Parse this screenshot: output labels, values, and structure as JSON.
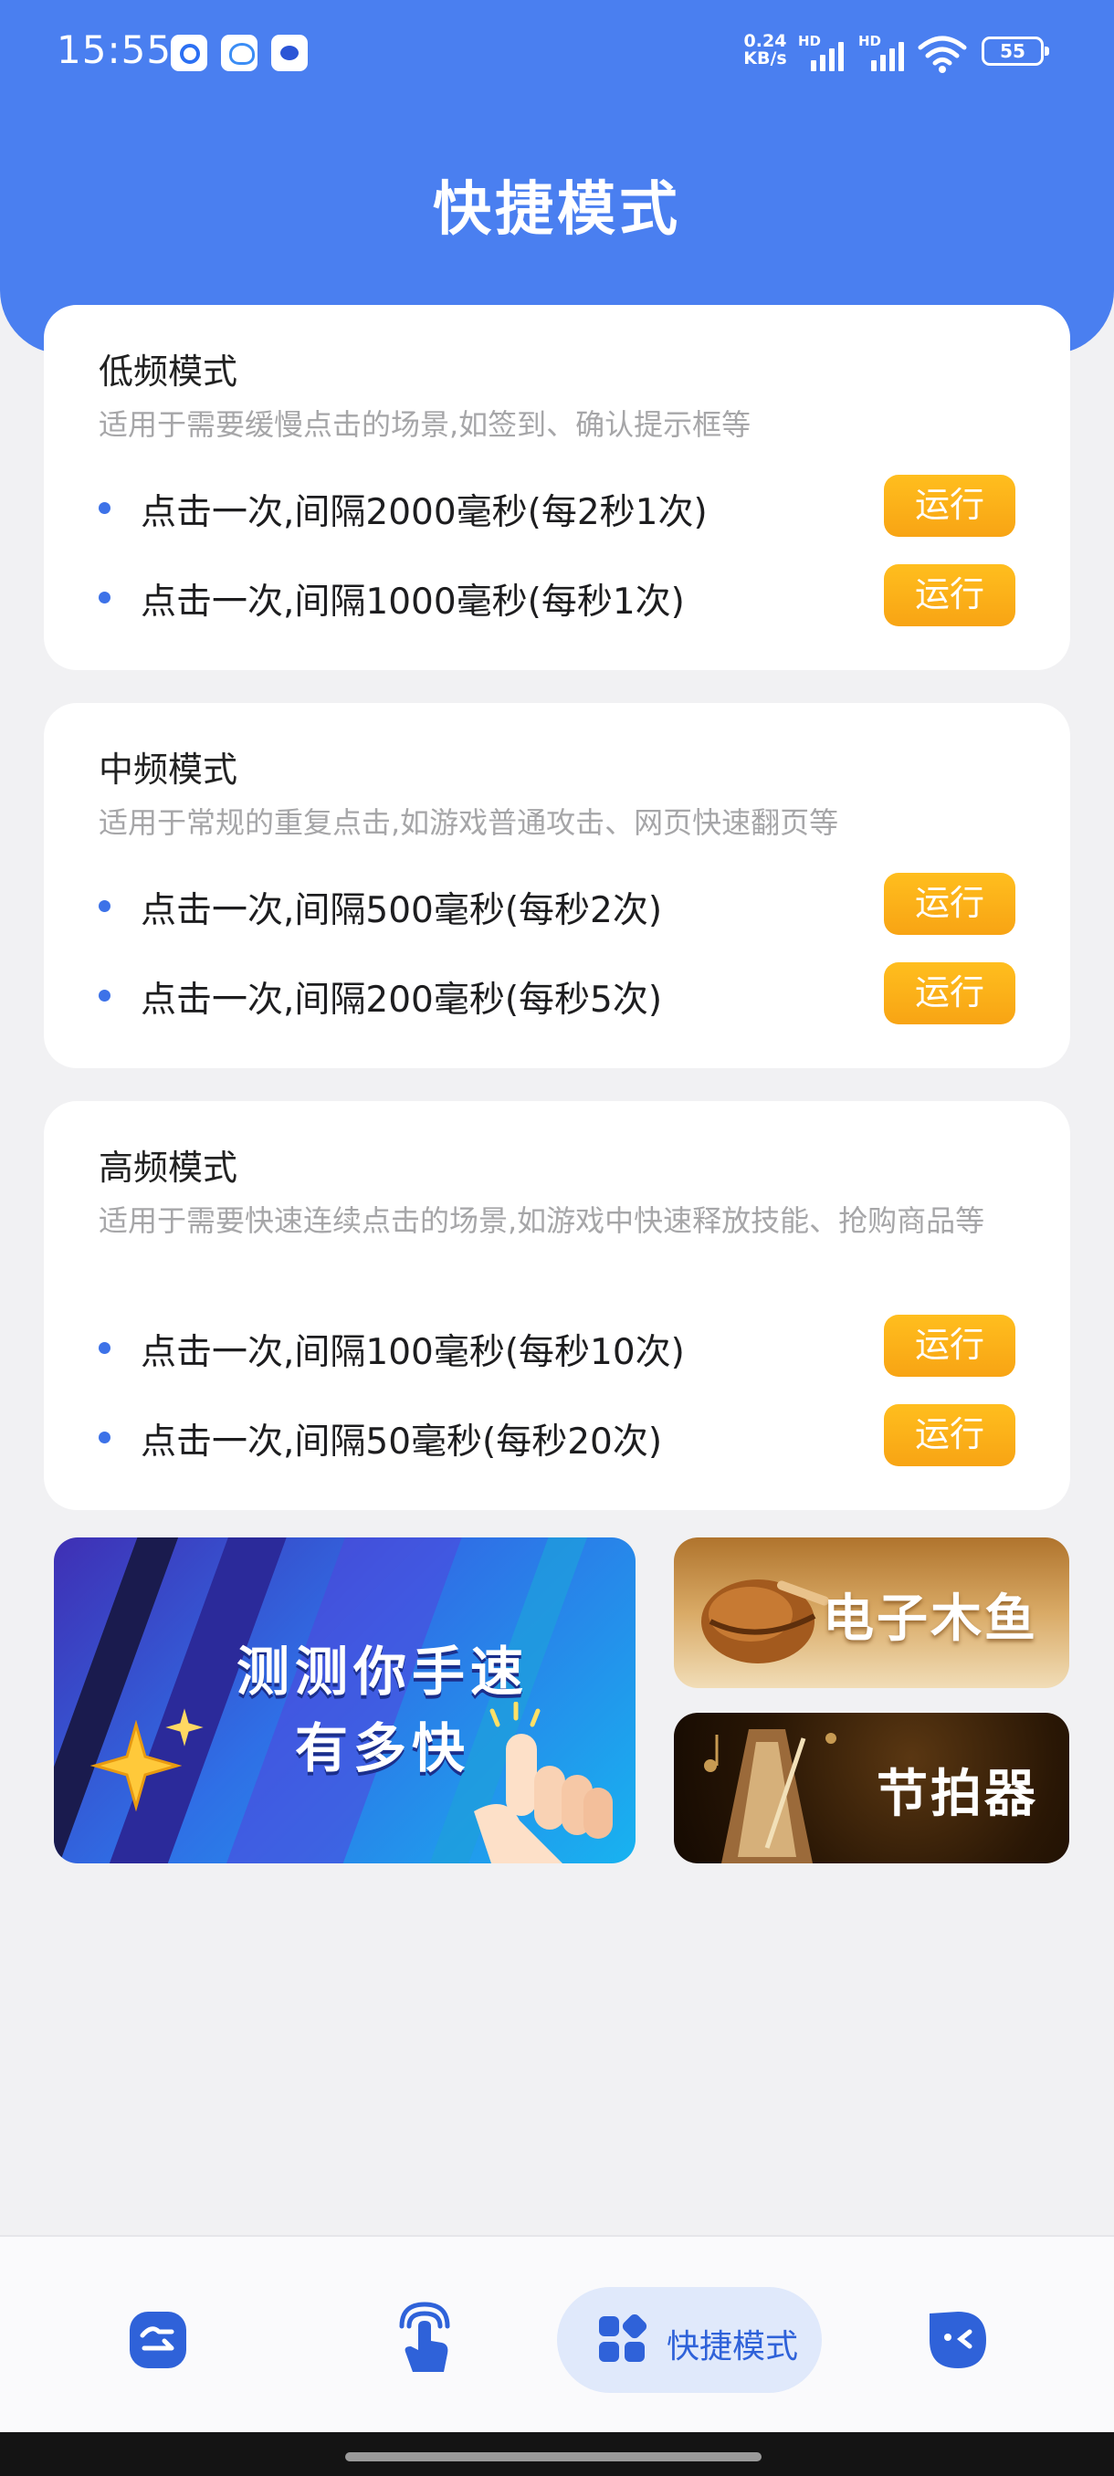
{
  "status_bar": {
    "time": "15:55",
    "speed_value": "0.24",
    "speed_unit": "KB/s",
    "network_1": "HD",
    "network_2": "HD",
    "battery": "55"
  },
  "header": {
    "title": "快捷模式"
  },
  "sections": [
    {
      "title": "低频模式",
      "description": "适用于需要缓慢点击的场景,如签到、确认提示框等",
      "items": [
        {
          "label": "点击一次,间隔2000毫秒(每2秒1次)",
          "button": "运行"
        },
        {
          "label": "点击一次,间隔1000毫秒(每秒1次)",
          "button": "运行"
        }
      ]
    },
    {
      "title": "中频模式",
      "description": "适用于常规的重复点击,如游戏普通攻击、网页快速翻页等",
      "items": [
        {
          "label": "点击一次,间隔500毫秒(每秒2次)",
          "button": "运行"
        },
        {
          "label": "点击一次,间隔200毫秒(每秒5次)",
          "button": "运行"
        }
      ]
    },
    {
      "title": "高频模式",
      "description": "适用于需要快速连续点击的场景,如游戏中快速释放技能、抢购商品等",
      "items": [
        {
          "label": "点击一次,间隔100毫秒(每秒10次)",
          "button": "运行"
        },
        {
          "label": "点击一次,间隔50毫秒(每秒20次)",
          "button": "运行"
        }
      ]
    }
  ],
  "banners": {
    "speed_test_line1": "测测你手速",
    "speed_test_line2": "有多快",
    "wooden_fish": "电子木鱼",
    "metronome": "节拍器"
  },
  "nav": {
    "active_label": "快捷模式",
    "icons": [
      "home-icon",
      "tap-icon",
      "grid-icon",
      "face-icon"
    ]
  },
  "colors": {
    "header_blue": "#4a7ff0",
    "run_button": "#fbb11a",
    "bullet": "#3d72e8",
    "nav_active_bg": "#e0e9fb"
  }
}
